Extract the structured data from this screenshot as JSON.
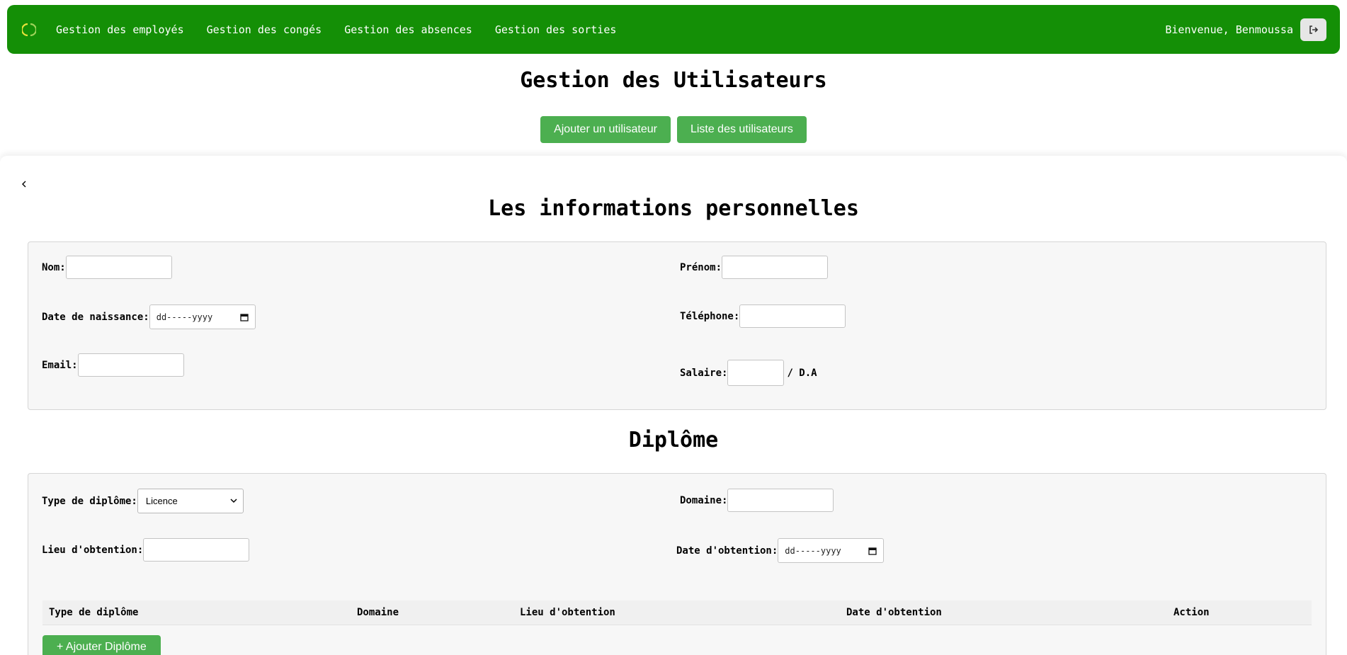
{
  "nav": {
    "items": [
      "Gestion des employés",
      "Gestion des congés",
      "Gestion des absences",
      "Gestion des sorties"
    ],
    "welcome": "Bienvenue, Benmoussa",
    "logo_icon": "circle-logo-icon",
    "logout_icon": "logout-icon"
  },
  "header": {
    "title": "Gestion des Utilisateurs",
    "add_user_label": "Ajouter un utilisateur",
    "list_users_label": "Liste des utilisateurs"
  },
  "personal": {
    "title": "Les informations personnelles",
    "nom_label": "Nom:",
    "prenom_label": "Prénom:",
    "birth_label": "Date de naissance:",
    "birth_placeholder": "dd-----yyyy",
    "phone_label": "Téléphone:",
    "email_label": "Email:",
    "salary_label": "Salaire:",
    "salary_unit": "/ D.A"
  },
  "diplome": {
    "title": "Diplôme",
    "type_label": "Type de diplôme:",
    "type_value": "Licence",
    "domaine_label": "Domaine:",
    "lieu_label": "Lieu d'obtention:",
    "date_label": "Date d'obtention:",
    "date_placeholder": "dd-----yyyy",
    "table_headers": [
      "Type de diplôme",
      "Domaine",
      "Lieu d'obtention",
      "Date d'obtention",
      "Action"
    ],
    "add_label": "+ Ajouter Diplôme"
  },
  "colors": {
    "navbar": "#148f06",
    "button": "#4caf50"
  }
}
